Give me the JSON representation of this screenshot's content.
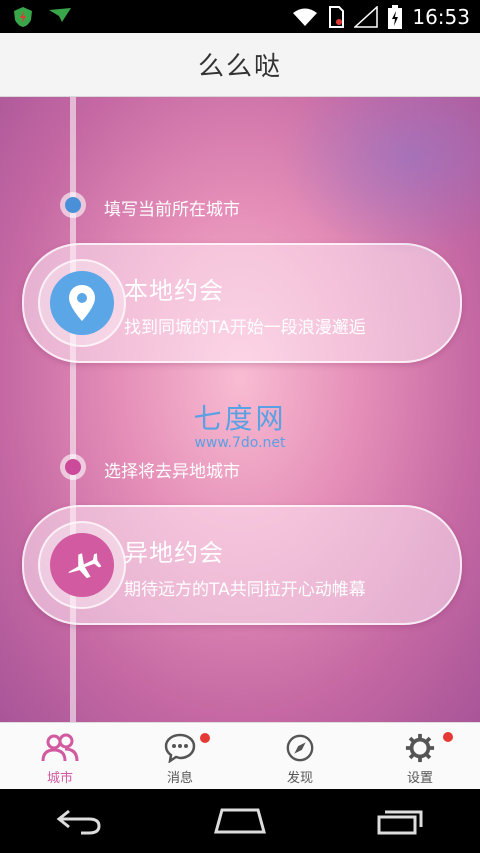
{
  "status_bar": {
    "time": "16:53",
    "icons": [
      "shield-app-icon",
      "flag-app-icon",
      "wifi-icon",
      "sim-icon",
      "signal-icon",
      "battery-icon"
    ]
  },
  "header": {
    "title": "么么哒"
  },
  "main": {
    "step1": {
      "label": "填写当前所在城市",
      "dot_color": "#4a90d9"
    },
    "card1": {
      "title": "本地约会",
      "subtitle": "找到同城的TA开始一段浪漫邂逅",
      "icon": "location-pin-icon",
      "icon_color": "#5aa6e6"
    },
    "watermark": {
      "text": "七度网",
      "url": "www.7do.net"
    },
    "step2": {
      "label": "选择将去异地城市",
      "dot_color": "#cc4a9a"
    },
    "card2": {
      "title": "异地约会",
      "subtitle": "期待远方的TA共同拉开心动帷幕",
      "icon": "airplane-icon",
      "icon_color": "#d25aa0"
    }
  },
  "tabs": [
    {
      "label": "城市",
      "icon": "people-icon",
      "active": true,
      "badge": false
    },
    {
      "label": "消息",
      "icon": "chat-icon",
      "active": false,
      "badge": true
    },
    {
      "label": "发现",
      "icon": "compass-icon",
      "active": false,
      "badge": false
    },
    {
      "label": "设置",
      "icon": "gear-icon",
      "active": false,
      "badge": true
    }
  ],
  "nav": [
    "back-icon",
    "home-icon",
    "recents-icon"
  ],
  "colors": {
    "accent": "#d25aa0",
    "badge": "#e53935"
  }
}
